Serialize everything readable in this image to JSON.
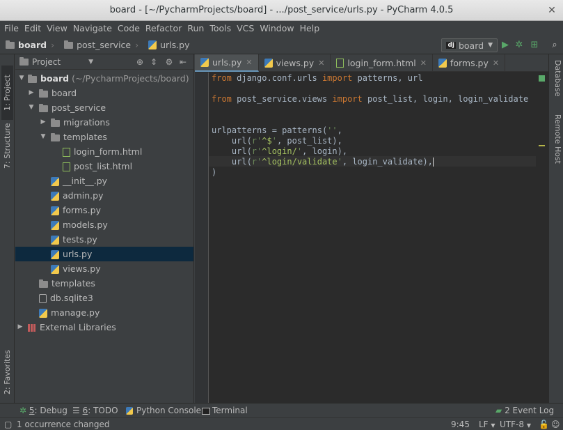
{
  "window": {
    "title": "board - [~/PycharmProjects/board] - .../post_service/urls.py - PyCharm 4.0.5"
  },
  "menu": [
    "File",
    "Edit",
    "View",
    "Navigate",
    "Code",
    "Refactor",
    "Run",
    "Tools",
    "VCS",
    "Window",
    "Help"
  ],
  "breadcrumbs": [
    "board",
    "post_service",
    "urls.py"
  ],
  "run_config": {
    "label": "board",
    "badge": "dj"
  },
  "left_tabs": {
    "project": "1: Project",
    "structure": "7: Structure",
    "favorites": "2: Favorites"
  },
  "right_tabs": {
    "database": "Database",
    "remote_host": "Remote Host"
  },
  "project_panel": {
    "title": "Project"
  },
  "tree": [
    {
      "label": "board",
      "suffix": "(~/PycharmProjects/board)",
      "icon": "folder-icon",
      "expanded": true
    },
    {
      "label": "board",
      "icon": "folder-icon",
      "expanded": false
    },
    {
      "label": "post_service",
      "icon": "folder-icon",
      "expanded": true
    },
    {
      "label": "migrations",
      "icon": "folder-icon",
      "expanded": false
    },
    {
      "label": "templates",
      "icon": "folder-icon",
      "expanded": true
    },
    {
      "label": "login_form.html",
      "icon": "html-file-icon"
    },
    {
      "label": "post_list.html",
      "icon": "html-file-icon"
    },
    {
      "label": "__init__.py",
      "icon": "python-file-icon"
    },
    {
      "label": "admin.py",
      "icon": "python-file-icon"
    },
    {
      "label": "forms.py",
      "icon": "python-file-icon"
    },
    {
      "label": "models.py",
      "icon": "python-file-icon"
    },
    {
      "label": "tests.py",
      "icon": "python-file-icon"
    },
    {
      "label": "urls.py",
      "icon": "python-file-icon",
      "selected": true
    },
    {
      "label": "views.py",
      "icon": "python-file-icon"
    },
    {
      "label": "templates",
      "icon": "folder-icon"
    },
    {
      "label": "db.sqlite3",
      "icon": "file-icon"
    },
    {
      "label": "manage.py",
      "icon": "python-file-icon"
    },
    {
      "label": "External Libraries",
      "icon": "library-icon",
      "expanded": false
    }
  ],
  "editor_tabs": [
    {
      "label": "urls.py",
      "active": true
    },
    {
      "label": "views.py"
    },
    {
      "label": "login_form.html"
    },
    {
      "label": "forms.py"
    }
  ],
  "code": {
    "l1": {
      "kw1": "from",
      "mod": " django.conf.urls ",
      "kw2": "import",
      "rest": " patterns, url"
    },
    "l2": {
      "kw1": "from",
      "mod": " post_service.views ",
      "kw2": "import",
      "rest": " post_list, login, login_validate"
    },
    "l3": {
      "a": "urlpatterns = patterns(",
      "s": "''",
      "b": ","
    },
    "l4": {
      "a": "    url(",
      "p": "r'",
      "rx": "^$",
      "q": "'",
      "b": ", post_list),"
    },
    "l5": {
      "a": "    url(",
      "p": "r'",
      "rx": "^login/",
      "q": "'",
      "b": ", login),"
    },
    "l6": {
      "a": "    url(",
      "p": "r'",
      "rx": "^login/validate",
      "q": "'",
      "b": ", login_validate),"
    },
    "l7": ")"
  },
  "bottom_tabs": [
    {
      "key": "5",
      "label": ": Debug"
    },
    {
      "key": "6",
      "label": ": TODO"
    },
    {
      "key": "",
      "label": "Python Console"
    },
    {
      "key": "",
      "label": "Terminal"
    }
  ],
  "event_log": "2 Event Log",
  "status": {
    "message": "1 occurrence changed",
    "position": "9:45",
    "line_sep": "LF",
    "encoding": "UTF-8"
  }
}
